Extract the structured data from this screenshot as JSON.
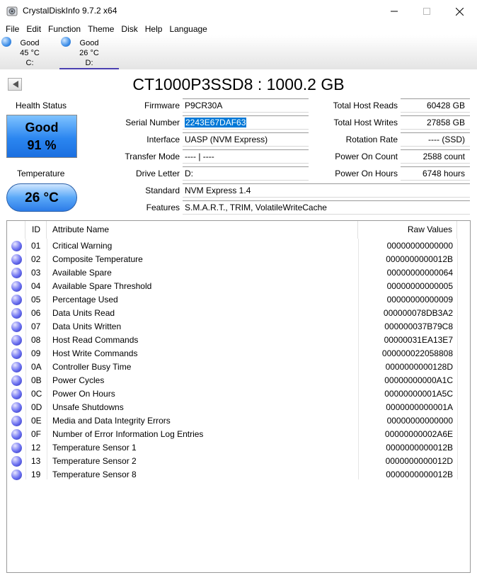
{
  "window": {
    "title": "CrystalDiskInfo 9.7.2 x64"
  },
  "menu": [
    "File",
    "Edit",
    "Function",
    "Theme",
    "Disk",
    "Help",
    "Language"
  ],
  "drives": [
    {
      "status": "Good",
      "temp": "45 °C",
      "letter": "C:"
    },
    {
      "status": "Good",
      "temp": "26 °C",
      "letter": "D:"
    }
  ],
  "disk": {
    "title": "CT1000P3SSD8 : 1000.2 GB",
    "health_label": "Health Status",
    "health_status": "Good",
    "health_percent": "91 %",
    "temp_label": "Temperature",
    "temperature": "26 °C"
  },
  "info_left": {
    "firmware_label": "Firmware",
    "firmware": "P9CR30A",
    "serial_label": "Serial Number",
    "serial": "2243E67DAF63",
    "interface_label": "Interface",
    "interface": "UASP (NVM Express)",
    "transfer_label": "Transfer Mode",
    "transfer": "---- | ----",
    "letter_label": "Drive Letter",
    "letter": "D:",
    "standard_label": "Standard",
    "standard": "NVM Express 1.4",
    "features_label": "Features",
    "features": "S.M.A.R.T., TRIM, VolatileWriteCache"
  },
  "info_right": {
    "reads_label": "Total Host Reads",
    "reads": "60428 GB",
    "writes_label": "Total Host Writes",
    "writes": "27858 GB",
    "rotation_label": "Rotation Rate",
    "rotation": "---- (SSD)",
    "count_label": "Power On Count",
    "count": "2588 count",
    "hours_label": "Power On Hours",
    "hours": "6748 hours"
  },
  "table": {
    "headers": {
      "id": "ID",
      "name": "Attribute Name",
      "raw": "Raw Values"
    },
    "rows": [
      {
        "id": "01",
        "name": "Critical Warning",
        "raw": "00000000000000"
      },
      {
        "id": "02",
        "name": "Composite Temperature",
        "raw": "0000000000012B"
      },
      {
        "id": "03",
        "name": "Available Spare",
        "raw": "00000000000064"
      },
      {
        "id": "04",
        "name": "Available Spare Threshold",
        "raw": "00000000000005"
      },
      {
        "id": "05",
        "name": "Percentage Used",
        "raw": "00000000000009"
      },
      {
        "id": "06",
        "name": "Data Units Read",
        "raw": "000000078DB3A2"
      },
      {
        "id": "07",
        "name": "Data Units Written",
        "raw": "000000037B79C8"
      },
      {
        "id": "08",
        "name": "Host Read Commands",
        "raw": "00000031EA13E7"
      },
      {
        "id": "09",
        "name": "Host Write Commands",
        "raw": "000000022058808"
      },
      {
        "id": "0A",
        "name": "Controller Busy Time",
        "raw": "0000000000128D"
      },
      {
        "id": "0B",
        "name": "Power Cycles",
        "raw": "00000000000A1C"
      },
      {
        "id": "0C",
        "name": "Power On Hours",
        "raw": "00000000001A5C"
      },
      {
        "id": "0D",
        "name": "Unsafe Shutdowns",
        "raw": "0000000000001A"
      },
      {
        "id": "0E",
        "name": "Media and Data Integrity Errors",
        "raw": "00000000000000"
      },
      {
        "id": "0F",
        "name": "Number of Error Information Log Entries",
        "raw": "00000000002A6E"
      },
      {
        "id": "12",
        "name": "Temperature Sensor 1",
        "raw": "0000000000012B"
      },
      {
        "id": "13",
        "name": "Temperature Sensor 2",
        "raw": "0000000000012D"
      },
      {
        "id": "19",
        "name": "Temperature Sensor 8",
        "raw": "0000000000012B"
      }
    ]
  },
  "colors": {
    "health_blue": "#2b86f0",
    "selection": "#0078d7"
  }
}
